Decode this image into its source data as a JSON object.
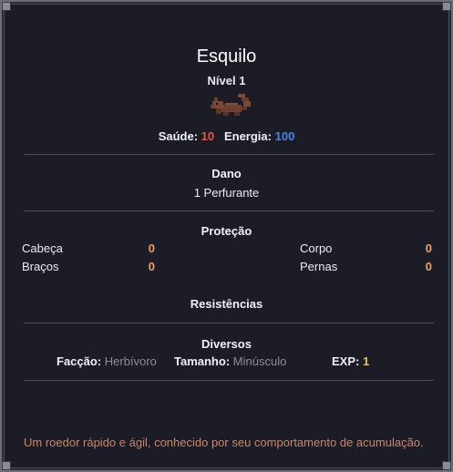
{
  "creature": {
    "name": "Esquilo",
    "level": "Nível 1",
    "sprite_icon": "squirrel-sprite-icon"
  },
  "stats": {
    "health_label": "Saúde:",
    "health_value": "10",
    "energy_label": "Energia:",
    "energy_value": "100"
  },
  "damage": {
    "title": "Dano",
    "value": "1 Perfurante"
  },
  "protection": {
    "title": "Proteção",
    "items": [
      {
        "label": "Cabeça",
        "value": "0"
      },
      {
        "label": "Corpo",
        "value": "0"
      },
      {
        "label": "Braços",
        "value": "0"
      },
      {
        "label": "Pernas",
        "value": "0"
      }
    ]
  },
  "resistances": {
    "title": "Resistências"
  },
  "misc": {
    "title": "Diversos",
    "faction_label": "Facção:",
    "faction_value": "Herbívoro",
    "size_label": "Tamanho:",
    "size_value": "Minúsculo",
    "exp_label": "EXP:",
    "exp_value": "1"
  },
  "description": "Um roedor rápido e ágil, conhecido por seu comportamento de acumulação.",
  "colors": {
    "health": "#e05a4e",
    "energy": "#4f84e8",
    "protection_value": "#e8a25e",
    "exp_value": "#f2c04a",
    "description": "#c9866a"
  }
}
